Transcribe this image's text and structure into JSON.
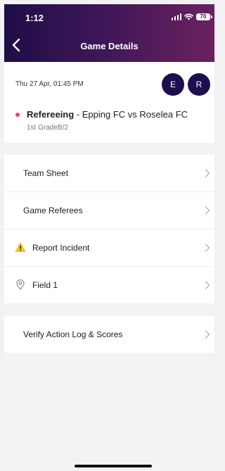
{
  "status_bar": {
    "time": "1:12",
    "battery": "70"
  },
  "header": {
    "title": "Game Details"
  },
  "game": {
    "datetime": "Thu 27 Apr, 01:45 PM",
    "avatars": [
      "E",
      "R"
    ],
    "role": "Refereeing",
    "separator": " - ",
    "matchup": "Epping FC vs Roselea FC",
    "grade": "1st GradeB/2"
  },
  "menu": {
    "team_sheet": "Team Sheet",
    "game_referees": "Game Referees",
    "report_incident": "Report Incident",
    "field": "Field 1",
    "verify": "Verify Action Log & Scores"
  },
  "colors": {
    "header_start": "#1f0d47",
    "header_end": "#6b2160",
    "avatar": "#1d0e4f",
    "status_dot": "#ec3f7e",
    "warning": "#f5c518"
  },
  "icons": {
    "back": "chevron-left-icon",
    "incident": "warning-icon",
    "field": "location-pin-icon",
    "row_arrow": "chevron-right-icon"
  }
}
